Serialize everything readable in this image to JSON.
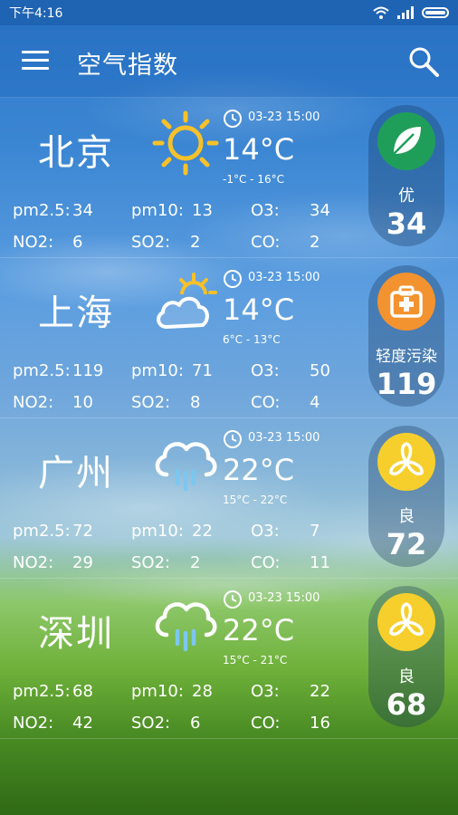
{
  "status_bar": {
    "time": "下午4:16"
  },
  "app_bar": {
    "title": "空气指数"
  },
  "cities": [
    {
      "name": "北京",
      "weather_icon": "sun-icon",
      "update_time": "03-23 15:00",
      "temperature": "14°C",
      "range": "-1°C - 16°C",
      "metrics": {
        "pm25_label": "pm2.5:",
        "pm25": "34",
        "pm10_label": "pm10:",
        "pm10": "13",
        "o3_label": "O3:",
        "o3": "34",
        "no2_label": "NO2:",
        "no2": "6",
        "so2_label": "SO2:",
        "so2": "2",
        "co_label": "CO:",
        "co": "2"
      },
      "aqi": {
        "level": "优",
        "value": "34",
        "icon": "leaf-icon",
        "color": "#1f9e5a"
      }
    },
    {
      "name": "上海",
      "weather_icon": "partly-cloudy-icon",
      "update_time": "03-23 15:00",
      "temperature": "14°C",
      "range": "6°C - 13°C",
      "metrics": {
        "pm25_label": "pm2.5:",
        "pm25": "119",
        "pm10_label": "pm10:",
        "pm10": "71",
        "o3_label": "O3:",
        "o3": "50",
        "no2_label": "NO2:",
        "no2": "10",
        "so2_label": "SO2:",
        "so2": "8",
        "co_label": "CO:",
        "co": "4"
      },
      "aqi": {
        "level": "轻度污染",
        "value": "119",
        "icon": "first-aid-kit-icon",
        "color": "#f39330"
      }
    },
    {
      "name": "广州",
      "weather_icon": "rain-cloud-icon",
      "update_time": "03-23 15:00",
      "temperature": "22°C",
      "range": "15°C - 22°C",
      "metrics": {
        "pm25_label": "pm2.5:",
        "pm25": "72",
        "pm10_label": "pm10:",
        "pm10": "22",
        "o3_label": "O3:",
        "o3": "7",
        "no2_label": "NO2:",
        "no2": "29",
        "so2_label": "SO2:",
        "so2": "2",
        "co_label": "CO:",
        "co": "11"
      },
      "aqi": {
        "level": "良",
        "value": "72",
        "icon": "fan-icon",
        "color": "#f6cf2c"
      }
    },
    {
      "name": "深圳",
      "weather_icon": "rain-cloud-icon",
      "update_time": "03-23 15:00",
      "temperature": "22°C",
      "range": "15°C - 21°C",
      "metrics": {
        "pm25_label": "pm2.5:",
        "pm25": "68",
        "pm10_label": "pm10:",
        "pm10": "28",
        "o3_label": "O3:",
        "o3": "22",
        "no2_label": "NO2:",
        "no2": "42",
        "so2_label": "SO2:",
        "so2": "6",
        "co_label": "CO:",
        "co": "16"
      },
      "aqi": {
        "level": "良",
        "value": "68",
        "icon": "fan-icon",
        "color": "#f6cf2c"
      }
    }
  ]
}
